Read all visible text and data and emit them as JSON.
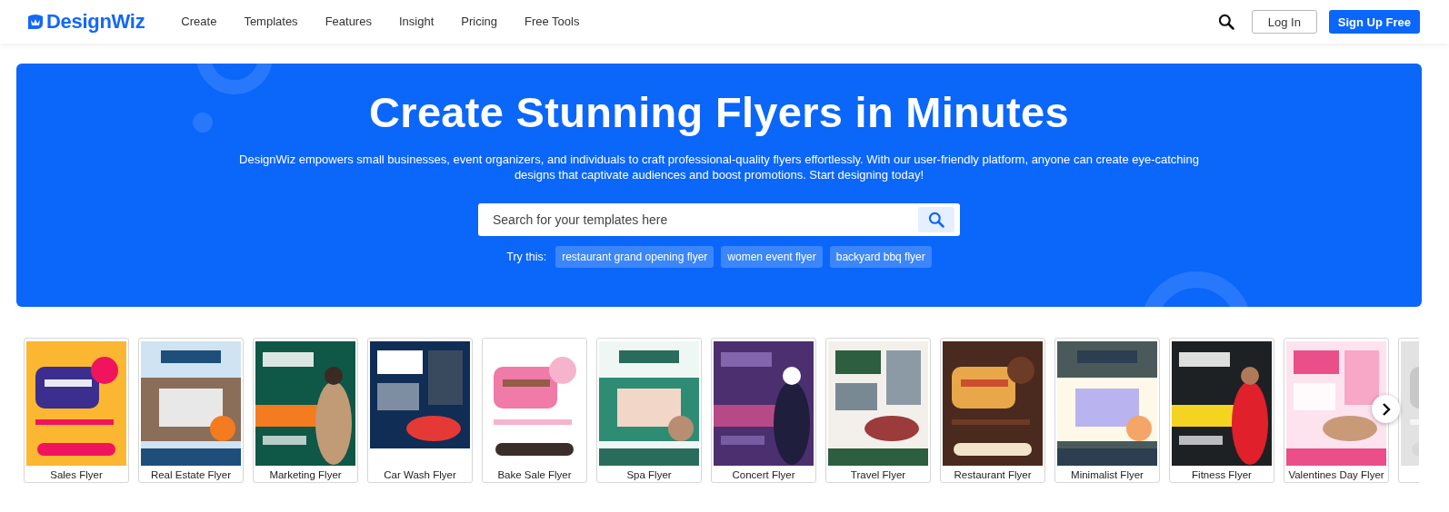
{
  "header": {
    "logo": "DesignWiz",
    "nav": [
      {
        "label": "Create"
      },
      {
        "label": "Templates"
      },
      {
        "label": "Features"
      },
      {
        "label": "Insight"
      },
      {
        "label": "Pricing"
      },
      {
        "label": "Free Tools"
      }
    ],
    "login": "Log In",
    "signup": "Sign Up Free"
  },
  "hero": {
    "title": "Create Stunning Flyers in Minutes",
    "description": "DesignWiz empowers small businesses, event organizers, and individuals to craft professional-quality flyers effortlessly. With our user-friendly platform, anyone can create eye-catching designs that captivate audiences and boost promotions. Start designing today!",
    "search": {
      "placeholder": "Search for your templates here"
    },
    "try_label": "Try this:",
    "suggestions": [
      "restaurant grand opening flyer",
      "women event flyer",
      "backyard bbq flyer"
    ]
  },
  "flyers": [
    {
      "label": "Sales Flyer",
      "kind": "picture"
    },
    {
      "label": "Real Estate Flyer",
      "kind": "picture"
    },
    {
      "label": "Marketing Flyer",
      "kind": "picture"
    },
    {
      "label": "Car Wash Flyer",
      "kind": "picture"
    },
    {
      "label": "Bake Sale Flyer",
      "kind": "picture"
    },
    {
      "label": "Spa Flyer",
      "kind": "picture"
    },
    {
      "label": "Concert Flyer",
      "kind": "picture"
    },
    {
      "label": "Travel Flyer",
      "kind": "picture"
    },
    {
      "label": "Restaurant Flyer",
      "kind": "picture"
    },
    {
      "label": "Minimalist Flyer",
      "kind": "picture"
    },
    {
      "label": "Fitness Flyer",
      "kind": "picture"
    },
    {
      "label": "Valentines Day Flyer",
      "kind": "picture"
    },
    {
      "kind": "picture"
    }
  ]
}
